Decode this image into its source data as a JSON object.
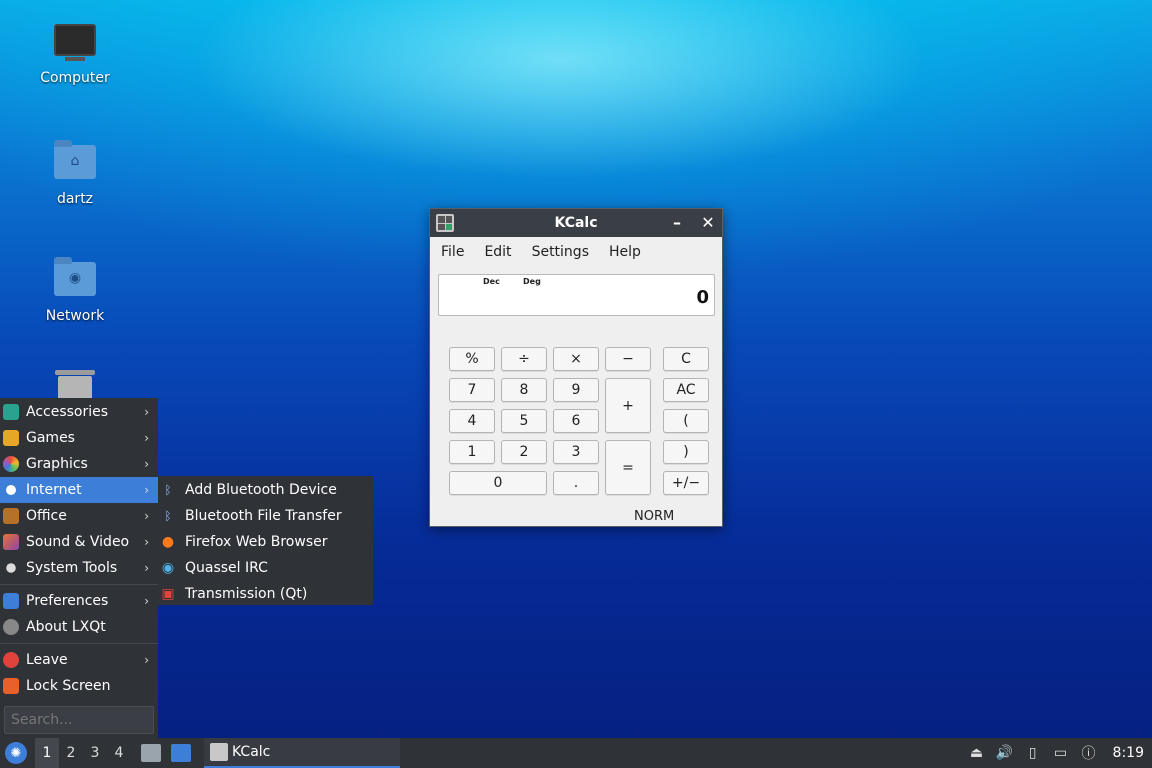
{
  "desktop": {
    "icons": [
      {
        "label": "Computer",
        "icon": "computer-icon"
      },
      {
        "label": "dartz",
        "icon": "home-folder-icon"
      },
      {
        "label": "Network",
        "icon": "network-folder-icon"
      },
      {
        "label": "",
        "icon": "trash-icon"
      }
    ]
  },
  "kcalc": {
    "title": "KCalc",
    "menu": [
      "File",
      "Edit",
      "Settings",
      "Help"
    ],
    "display": {
      "base": "Dec",
      "angle": "Deg",
      "value": "0"
    },
    "keys": [
      "%",
      "÷",
      "×",
      "−",
      "C",
      "7",
      "8",
      "9",
      "+",
      "AC",
      "4",
      "5",
      "6",
      "(",
      "1",
      "2",
      "3",
      "=",
      ")",
      "0",
      ".",
      "+/−"
    ],
    "status": "NORM"
  },
  "appmenu": {
    "items": [
      "Accessories",
      "Games",
      "Graphics",
      "Internet",
      "Office",
      "Sound & Video",
      "System Tools",
      "Preferences",
      "About LXQt",
      "Leave",
      "Lock Screen"
    ],
    "active": "Internet",
    "search_placeholder": "Search...",
    "submenu": [
      "Add Bluetooth Device",
      "Bluetooth File Transfer",
      "Firefox Web Browser",
      "Quassel IRC",
      "Transmission (Qt)"
    ]
  },
  "taskbar": {
    "desktops": [
      "1",
      "2",
      "3",
      "4"
    ],
    "current_desktop": "1",
    "task": "KCalc",
    "clock": "8:19"
  },
  "colors": {
    "panel": "#2f3237",
    "accent": "#3d7fd8",
    "window_title": "#3a3f45"
  }
}
